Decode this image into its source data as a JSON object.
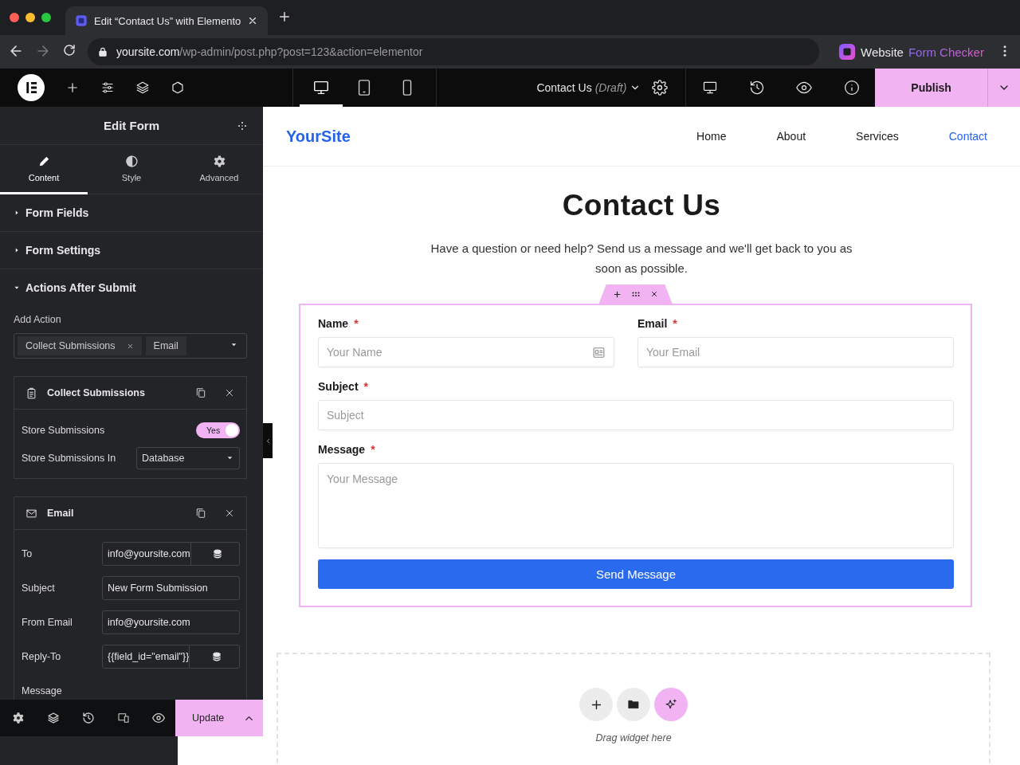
{
  "browser": {
    "tab_title": "Edit “Contact Us” with Elemento",
    "url_host": "yoursite.com",
    "url_path": "/wp-admin/post.php?post=123&action=elementor",
    "extension": {
      "name": "Website",
      "name_accent": "Form Checker"
    }
  },
  "topbar": {
    "devices": [
      {
        "kind": "desktop",
        "selected": true
      },
      {
        "kind": "tablet",
        "selected": false
      },
      {
        "kind": "mobile",
        "selected": false
      }
    ],
    "page_title": "Contact Us",
    "page_status": "(Draft)",
    "publish": "Publish"
  },
  "panel": {
    "title": "Edit Form",
    "tabs": [
      {
        "kind": "content",
        "label": "Content",
        "selected": true
      },
      {
        "kind": "style",
        "label": "Style",
        "selected": false
      },
      {
        "kind": "advanced",
        "label": "Advanced",
        "selected": false
      }
    ],
    "sections": [
      {
        "label": "Form Fields",
        "expanded": false
      },
      {
        "label": "Form Settings",
        "expanded": false
      },
      {
        "label": "Actions After Submit",
        "expanded": true
      }
    ],
    "add_action": {
      "label": "Add Action",
      "tags": [
        "Collect Submissions",
        "Email"
      ]
    },
    "actions": [
      {
        "kind": "collect",
        "title": "Collect Submissions",
        "rows": [
          {
            "kind": "toggle",
            "label": "Store Submissions",
            "on": true,
            "on_label": "Yes"
          },
          {
            "kind": "select",
            "label": "Store Submissions In",
            "value": "Database"
          }
        ]
      },
      {
        "kind": "email",
        "title": "Email",
        "rows": [
          {
            "kind": "input",
            "label": "To",
            "value": "info@yoursite.com",
            "dynamic": true
          },
          {
            "kind": "input",
            "label": "Subject",
            "value": "New Form Submission",
            "dynamic": false
          },
          {
            "kind": "input",
            "label": "From Email",
            "value": "info@yoursite.com",
            "dynamic": false
          },
          {
            "kind": "input",
            "label": "Reply-To",
            "value": "{{field_id=\"email\"}}",
            "dynamic": true
          },
          {
            "kind": "label",
            "label": "Message"
          }
        ]
      }
    ],
    "update": "Update"
  },
  "site": {
    "logo": "YourSite",
    "nav": [
      {
        "label": "Home",
        "selected": false
      },
      {
        "label": "About",
        "selected": false
      },
      {
        "label": "Services",
        "selected": false
      },
      {
        "label": "Contact",
        "selected": true
      }
    ],
    "heading": "Contact Us",
    "intro": "Have a question or need help? Send us a message and we'll get back to you as soon as possible.",
    "form": {
      "fields": [
        {
          "kind": "input",
          "label": "Name",
          "required": true,
          "placeholder": "Your Name",
          "autofill": true,
          "half": true
        },
        {
          "kind": "input",
          "label": "Email",
          "required": true,
          "placeholder": "Your Email",
          "autofill": false,
          "half": true
        },
        {
          "kind": "input",
          "label": "Subject",
          "required": true,
          "placeholder": "Subject",
          "autofill": false,
          "half": false
        },
        {
          "kind": "textarea",
          "label": "Message",
          "required": true,
          "placeholder": "Your Message",
          "autofill": false,
          "half": false
        }
      ],
      "required_mark": "*",
      "submit": "Send Message"
    },
    "drop_zone": {
      "hint": "Drag widget here"
    }
  }
}
